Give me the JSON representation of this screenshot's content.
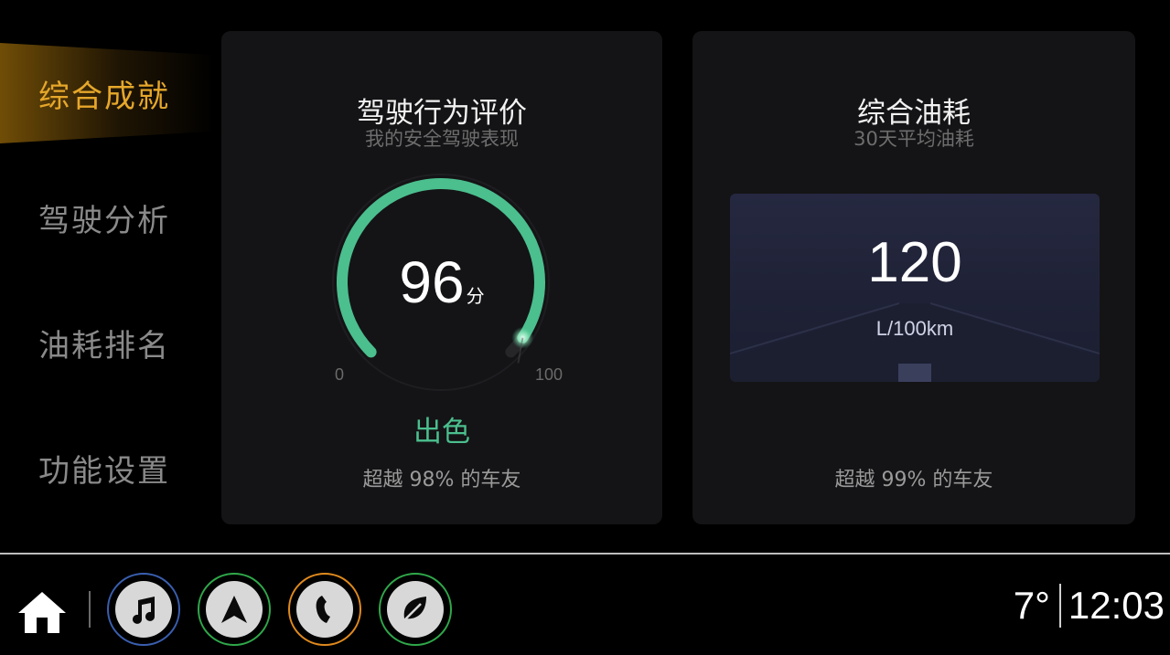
{
  "sidebar": {
    "items": [
      {
        "label": "综合成就",
        "active": true
      },
      {
        "label": "驾驶分析",
        "active": false
      },
      {
        "label": "油耗排名",
        "active": false
      },
      {
        "label": "功能设置",
        "active": false
      }
    ]
  },
  "driving_card": {
    "title": "驾驶行为评价",
    "subtitle": "我的安全驾驶表现",
    "score": "96",
    "score_unit": "分",
    "score_fraction": 0.96,
    "scale_min": "0",
    "scale_max": "100",
    "rating": "出色",
    "footer": "超越 98% 的车友",
    "accent_color": "#4bbf8e"
  },
  "fuel_card": {
    "title": "综合油耗",
    "subtitle": "30天平均油耗",
    "value": "120",
    "unit": "L/100km",
    "footer": "超越 99% 的车友"
  },
  "bottom_bar": {
    "buttons": [
      {
        "name": "music",
        "icon": "music-note-icon",
        "ring_color": "#3a5fb0"
      },
      {
        "name": "navigation",
        "icon": "navigation-arrow-icon",
        "ring_color": "#2fa84a"
      },
      {
        "name": "phone",
        "icon": "phone-icon",
        "ring_color": "#e08a1e"
      },
      {
        "name": "eco",
        "icon": "leaf-icon",
        "ring_color": "#2fa84a"
      }
    ],
    "temperature": "7°",
    "time": "12:03"
  },
  "colors": {
    "active_nav": "#e6a72a",
    "inactive_nav": "#8a8a8a",
    "card_bg": "#141416"
  }
}
